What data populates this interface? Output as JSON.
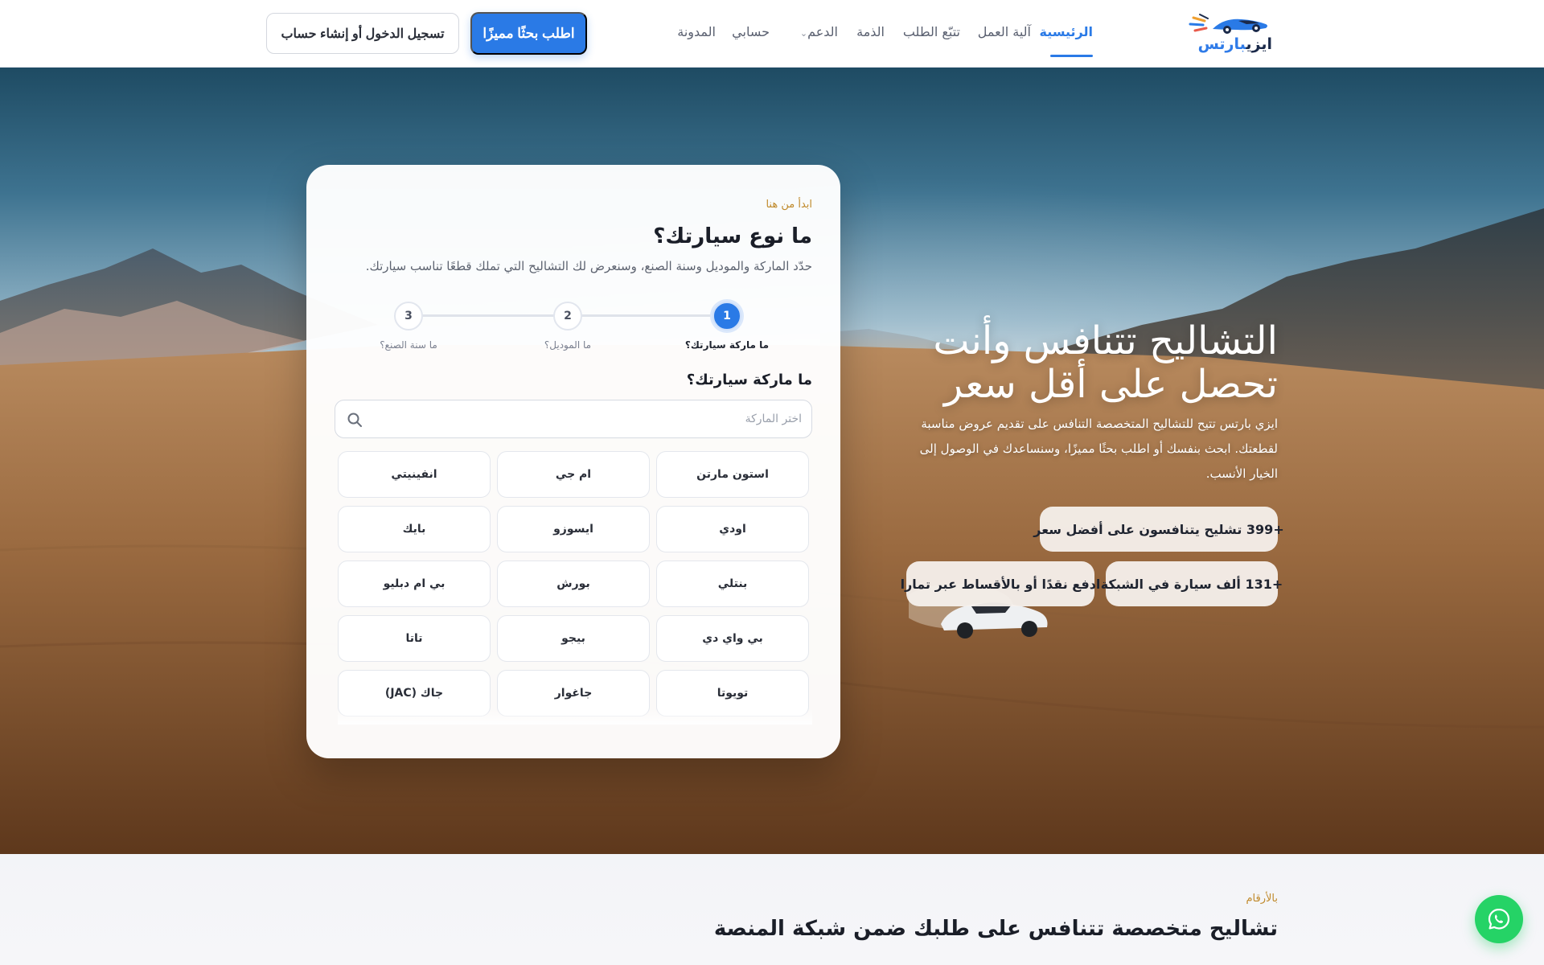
{
  "header": {
    "logo_text_dark": "ايزي",
    "logo_text_accent": "بارتس",
    "nav": [
      {
        "label": "الرئيسية",
        "active": true
      },
      {
        "label": "آلية العمل"
      },
      {
        "label": "تتبّع الطلب"
      },
      {
        "label": "الذمة"
      },
      {
        "label": "الدعم"
      },
      {
        "label": "حسابي"
      },
      {
        "label": "المدونة"
      }
    ],
    "cta_primary": "اطلب بحثًا مميزًا",
    "cta_secondary": "تسجيل الدخول أو إنشاء حساب"
  },
  "hero": {
    "title_line1": "التشاليح تتنافس وأنت",
    "title_line2": "تحصل على أقل سعر",
    "description": "ايزي بارتس تتيح للتشاليح المتخصصة التنافس على تقديم عروض مناسبة لقطعتك. ابحث بنفسك أو اطلب بحثًا مميزًا، وسنساعدك في الوصول إلى الخيار الأنسب.",
    "pills": [
      "+399 تشليح يتنافسون على أفضل سعر",
      "+131 ألف سيارة في الشبكة",
      "ادفع نقدًا أو بالأقساط عبر تمارا"
    ]
  },
  "finder": {
    "eyebrow": "ابدأ من هنا",
    "title": "ما نوع سيارتك؟",
    "description": "حدّد الماركة والموديل وسنة الصنع، وسنعرض لك التشاليح التي تملك قطعًا تناسب سيارتك.",
    "steps": [
      {
        "number": "1",
        "label": "ما ماركة سيارتك؟",
        "active": true
      },
      {
        "number": "2",
        "label": "ما الموديل؟"
      },
      {
        "number": "3",
        "label": "ما سنة الصنع؟"
      }
    ],
    "question": "ما ماركة سيارتك؟",
    "search_placeholder": "اختر الماركة",
    "brands": [
      "استون مارتن",
      "ام جي",
      "انفينيتي",
      "اودي",
      "ايسوزو",
      "بايك",
      "بنتلي",
      "بورش",
      "بي ام دبليو",
      "بي واي دي",
      "بيجو",
      "تاتا",
      "تويوتا",
      "جاغوار",
      "جاك (JAC)"
    ]
  },
  "stats": {
    "eyebrow": "بالأرقام",
    "title": "تشاليح متخصصة تتنافس على طلبك ضمن شبكة المنصة"
  },
  "colors": {
    "accent": "#2a7ae6",
    "eyebrow": "#c08a2b",
    "whatsapp": "#25d366"
  }
}
